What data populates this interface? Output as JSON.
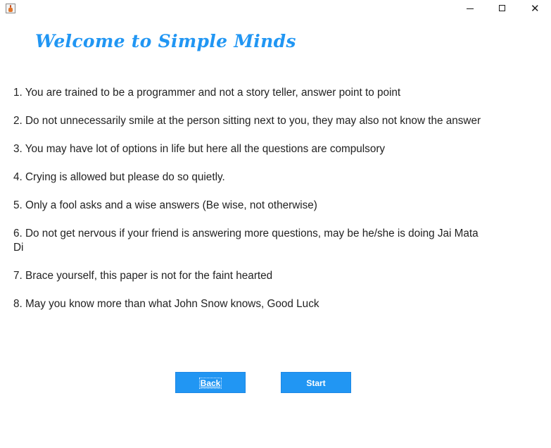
{
  "window": {
    "controls": {
      "minimize_icon": "minimize-icon",
      "maximize_icon": "maximize-icon",
      "close_icon": "close-icon",
      "close_glyph": "✕"
    }
  },
  "header": {
    "title": "Welcome to Simple Minds",
    "color": "#2196f3"
  },
  "rules": [
    "1. You are trained to be a programmer and not a story teller, answer point to point",
    "2. Do not unnecessarily smile at the person sitting next to you, they may also not know the answer",
    "3. You may have lot of options in life but here all the questions are compulsory",
    "4. Crying is allowed but please do so quietly.",
    "5. Only a fool asks and a wise answers (Be wise, not otherwise)",
    "6. Do not get nervous if your friend is answering more questions, may be he/she is doing Jai Mata Di",
    "7. Brace yourself, this paper is not for the faint hearted",
    "8. May you know more than what John Snow knows, Good Luck"
  ],
  "buttons": {
    "back_label": "Back",
    "start_label": "Start",
    "color": "#2196f3"
  }
}
